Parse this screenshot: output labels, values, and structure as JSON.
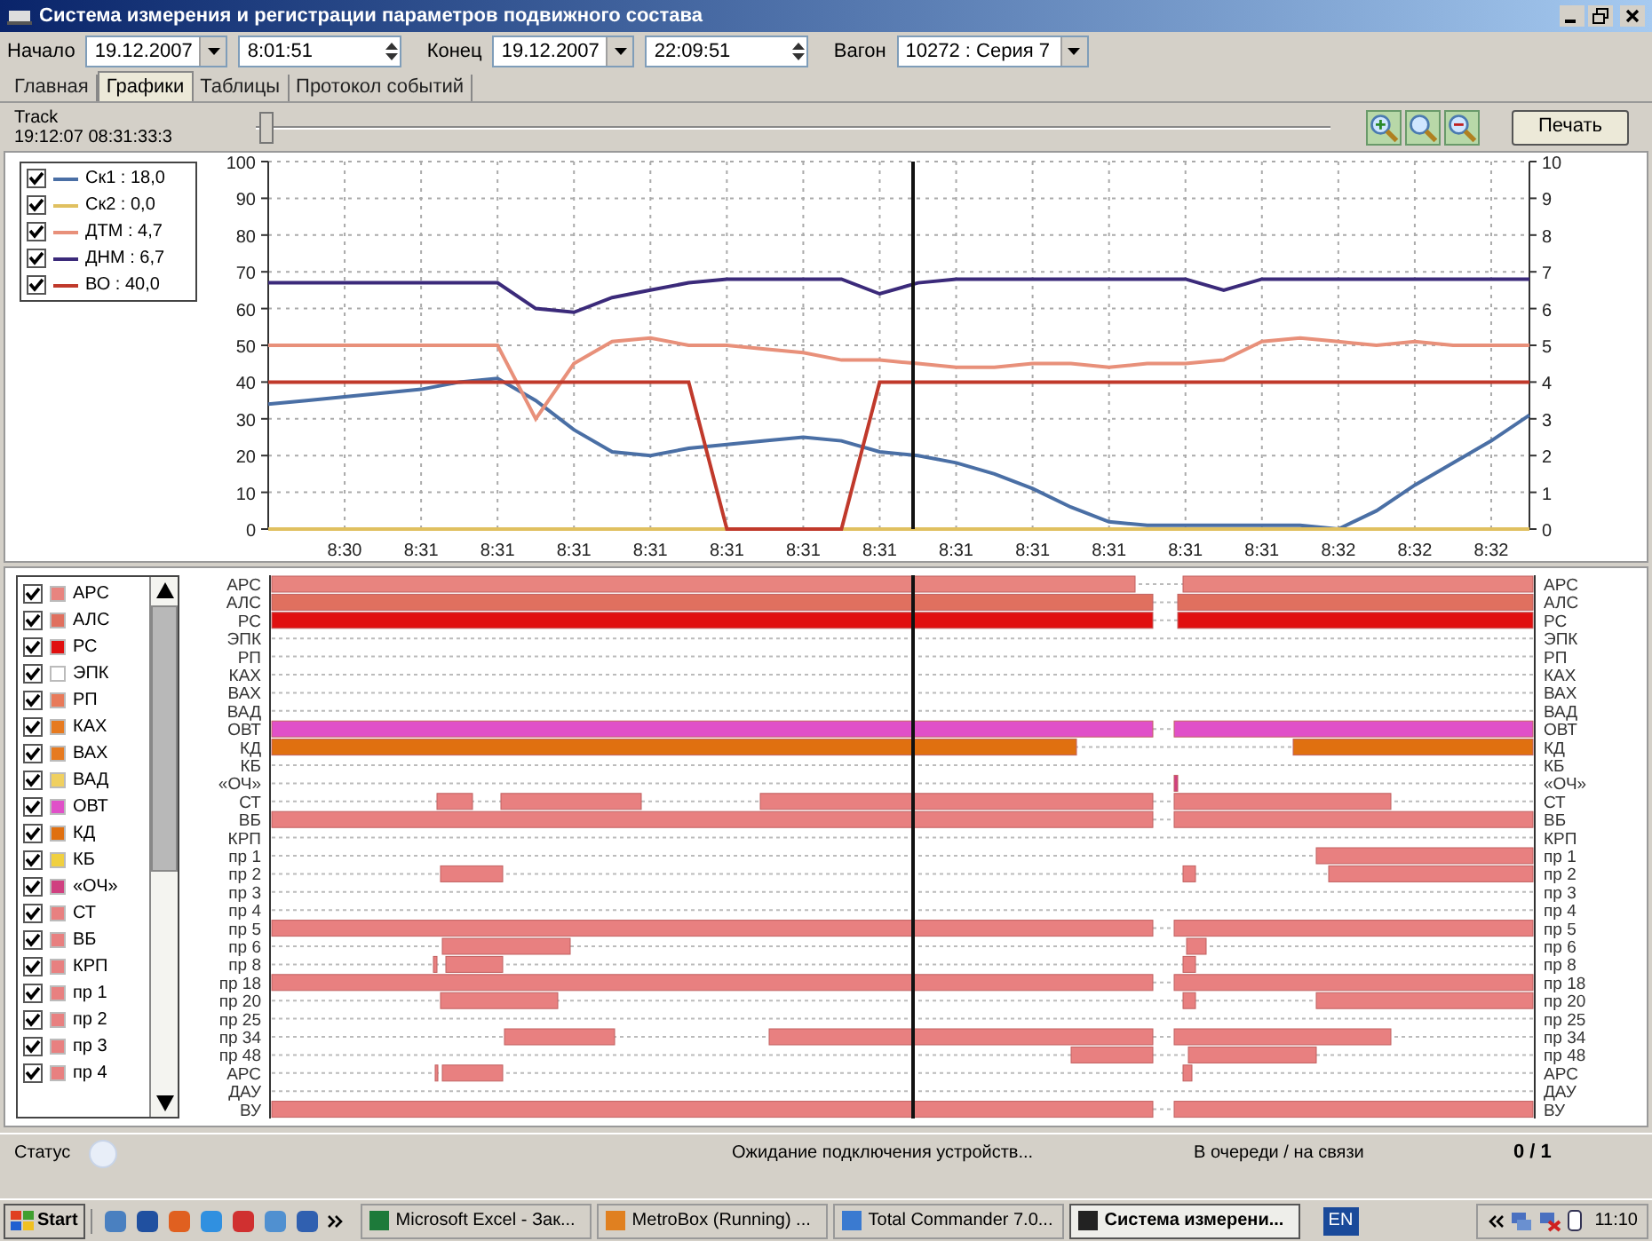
{
  "window": {
    "title": "Система измерения и регистрации параметров подвижного состава"
  },
  "toolbar": {
    "start_label": "Начало",
    "start_date": "19.12.2007",
    "start_time": "8:01:51",
    "end_label": "Конец",
    "end_date": "19.12.2007",
    "end_time": "22:09:51",
    "car_label": "Вагон",
    "car": "10272 : Серия 7"
  },
  "tabs": [
    {
      "label": "Главная",
      "selected": false
    },
    {
      "label": "Графики",
      "selected": true
    },
    {
      "label": "Таблицы",
      "selected": false
    },
    {
      "label": "Протокол событий",
      "selected": false
    }
  ],
  "track": {
    "label": "Track",
    "time": "19:12:07 08:31:33:3",
    "level": 0.01,
    "print_button": "Печать"
  },
  "graph": {
    "legend": [
      {
        "checked": true
      },
      {
        "checked": true
      },
      {
        "checked": true
      },
      {
        "checked": true
      },
      {
        "checked": true
      }
    ],
    "chart_data": {
      "type": "line",
      "categories": [
        null,
        null,
        "8:30",
        null,
        "8:31",
        null,
        "8:31",
        null,
        "8:31",
        null,
        "8:31",
        null,
        "8:31",
        null,
        "8:31",
        null,
        "8:31",
        null,
        "8:31",
        null,
        "8:31",
        null,
        "8:31",
        null,
        "8:31",
        null,
        "8:31",
        null,
        "8:32",
        null,
        "8:32",
        null,
        "8:32",
        null
      ],
      "ylim": [
        0,
        100
      ],
      "yticks": [
        0,
        10,
        20,
        30,
        40,
        50,
        60,
        70,
        80,
        90,
        100
      ],
      "y2lim": [
        0,
        10
      ],
      "grid": true,
      "y2ticks": [
        0,
        1,
        2,
        3,
        4,
        5,
        6,
        7,
        8,
        9,
        10
      ],
      "series": [
        {
          "name": "Ск1 : 18,0",
          "color": "#4a6fa5",
          "values": [
            34,
            35,
            36,
            37,
            38,
            40,
            41,
            35,
            27,
            21,
            20,
            22,
            23,
            24,
            25,
            24,
            21,
            20,
            18,
            15,
            11,
            6,
            2,
            1,
            1,
            1,
            1,
            1,
            0,
            5,
            12,
            18,
            24,
            31
          ]
        },
        {
          "name": "Ск2 : 0,0",
          "color": "#e0c060",
          "values": [
            0,
            0,
            0,
            0,
            0,
            0,
            0,
            0,
            0,
            0,
            0,
            0,
            0,
            0,
            0,
            0,
            0,
            0,
            0,
            0,
            0,
            0,
            0,
            0,
            0,
            0,
            0,
            0,
            0,
            0,
            0,
            0,
            0,
            0
          ]
        },
        {
          "name": "ДТМ : 4,7",
          "color": "#e8907a",
          "values": [
            50,
            50,
            50,
            50,
            50,
            50,
            50,
            30,
            45,
            51,
            52,
            50,
            50,
            49,
            48,
            46,
            46,
            45,
            44,
            44,
            45,
            45,
            44,
            45,
            45,
            46,
            51,
            52,
            51,
            50,
            51,
            50,
            50,
            50
          ]
        },
        {
          "name": "ДНМ : 6,7",
          "color": "#3b2a7a",
          "values": [
            67,
            67,
            67,
            67,
            67,
            67,
            67,
            60,
            59,
            63,
            65,
            67,
            68,
            68,
            68,
            68,
            64,
            67,
            68,
            68,
            68,
            68,
            68,
            68,
            68,
            65,
            68,
            68,
            68,
            68,
            68,
            68,
            68,
            68
          ]
        },
        {
          "name": "ВО : 40,0",
          "color": "#c0392b",
          "values": [
            40,
            40,
            40,
            40,
            40,
            40,
            40,
            40,
            40,
            40,
            40,
            40,
            0,
            0,
            0,
            0,
            40,
            40,
            40,
            40,
            40,
            40,
            40,
            40,
            40,
            40,
            40,
            40,
            40,
            40,
            40,
            40,
            40,
            40
          ]
        }
      ]
    }
  },
  "signals": {
    "items": [
      {
        "label": "АРС",
        "checked": true,
        "color": "#e8847f"
      },
      {
        "label": "АЛС",
        "checked": true,
        "color": "#e0705f"
      },
      {
        "label": "РС",
        "checked": true,
        "color": "#e01010"
      },
      {
        "label": "ЭПК",
        "checked": true,
        "color": "#ffffff"
      },
      {
        "label": "РП",
        "checked": true,
        "color": "#e87a5a"
      },
      {
        "label": "КАХ",
        "checked": true,
        "color": "#e67a20"
      },
      {
        "label": "ВАХ",
        "checked": true,
        "color": "#e67a20"
      },
      {
        "label": "ВАД",
        "checked": true,
        "color": "#f0d060"
      },
      {
        "label": "ОВТ",
        "checked": true,
        "color": "#e050c8"
      },
      {
        "label": "КД",
        "checked": true,
        "color": "#e07010"
      },
      {
        "label": "КБ",
        "checked": true,
        "color": "#f0d040"
      },
      {
        "label": "«ОЧ»",
        "checked": true,
        "color": "#d04080"
      },
      {
        "label": "СТ",
        "checked": true,
        "color": "#e88080"
      },
      {
        "label": "ВБ",
        "checked": true,
        "color": "#e88080"
      },
      {
        "label": "КРП",
        "checked": true,
        "color": "#e88080"
      },
      {
        "label": "пр 1",
        "checked": true,
        "color": "#e88080"
      },
      {
        "label": "пр 2",
        "checked": true,
        "color": "#e88080"
      },
      {
        "label": "пр 3",
        "checked": true,
        "color": "#e88080"
      },
      {
        "label": "пр 4",
        "checked": true,
        "color": "#e88080"
      }
    ],
    "rows": [
      {
        "label_left": "АРС",
        "label_right": "АРС",
        "color": "#e8847f"
      },
      {
        "label_left": "АЛС",
        "label_right": "АЛС",
        "color": "#e0705f"
      },
      {
        "label_left": "РС",
        "label_right": "РС",
        "color": "#e01010"
      },
      {
        "label_left": "ЭПК",
        "label_right": "ЭПК"
      },
      {
        "label_left": "РП",
        "label_right": "РП"
      },
      {
        "label_left": "КАХ",
        "label_right": "КАХ"
      },
      {
        "label_left": "ВАХ",
        "label_right": "ВАХ"
      },
      {
        "label_left": "ВАД",
        "label_right": "ВАД"
      },
      {
        "label_left": "ОВТ",
        "label_right": "ОВТ",
        "color": "#e050c8"
      },
      {
        "label_left": "КД",
        "label_right": "КД",
        "color": "#e07010"
      },
      {
        "label_left": "КБ",
        "label_right": "КБ"
      },
      {
        "label_left": "«ОЧ»",
        "label_right": "«ОЧ»",
        "color": "#d04080"
      },
      {
        "label_left": "СТ",
        "label_right": "СТ",
        "color": "#e88080"
      },
      {
        "label_left": "ВБ",
        "label_right": "ВБ",
        "color": "#e88080"
      },
      {
        "label_left": "КРП",
        "label_right": "КРП"
      },
      {
        "label_left": "пр 1",
        "label_right": "пр 1",
        "color": "#e88080"
      },
      {
        "label_left": "пр 2",
        "label_right": "пр 2",
        "color": "#e88080"
      },
      {
        "label_left": "пр 3",
        "label_right": "пр 3"
      },
      {
        "label_left": "пр 4",
        "label_right": "пр 4"
      },
      {
        "label_left": "пр 5",
        "label_right": "пр 5",
        "color": "#e88080"
      },
      {
        "label_left": "пр 6",
        "label_right": "пр 6",
        "color": "#e88080"
      },
      {
        "label_left": "пр 8",
        "label_right": "пр 8",
        "color": "#e88080"
      },
      {
        "label_left": "пр 18",
        "label_right": "пр 18",
        "color": "#e88080"
      },
      {
        "label_left": "пр 20",
        "label_right": "пр 20",
        "color": "#e88080"
      },
      {
        "label_left": "пр 25",
        "label_right": "пр 25"
      },
      {
        "label_left": "пр 34",
        "label_right": "пр 34",
        "color": "#e88080"
      },
      {
        "label_left": "пр 48",
        "label_right": "пр 48",
        "color": "#e88080"
      },
      {
        "label_left": "АРС",
        "label_right": "АРС",
        "color": "#e88080"
      },
      {
        "label_left": "ДАУ",
        "label_right": "ДАУ"
      },
      {
        "label_left": "ВУ",
        "label_right": "ВУ",
        "color": "#e88080"
      }
    ]
  },
  "status_bar": {
    "label": "Статус",
    "message": "Ожидание подключения устройств...",
    "queue_label": "В очереди / на связи",
    "queue_value": "0 / 1"
  },
  "taskbar": {
    "start": "Start",
    "tasks": [
      {
        "label": "Microsoft Excel - Зак...",
        "selected": false
      },
      {
        "label": "MetroBox (Running) ...",
        "selected": false
      },
      {
        "label": "Total Commander 7.0...",
        "selected": false
      },
      {
        "label": "Система измерени...",
        "selected": true
      }
    ],
    "language": "EN",
    "clock": "11:10"
  }
}
